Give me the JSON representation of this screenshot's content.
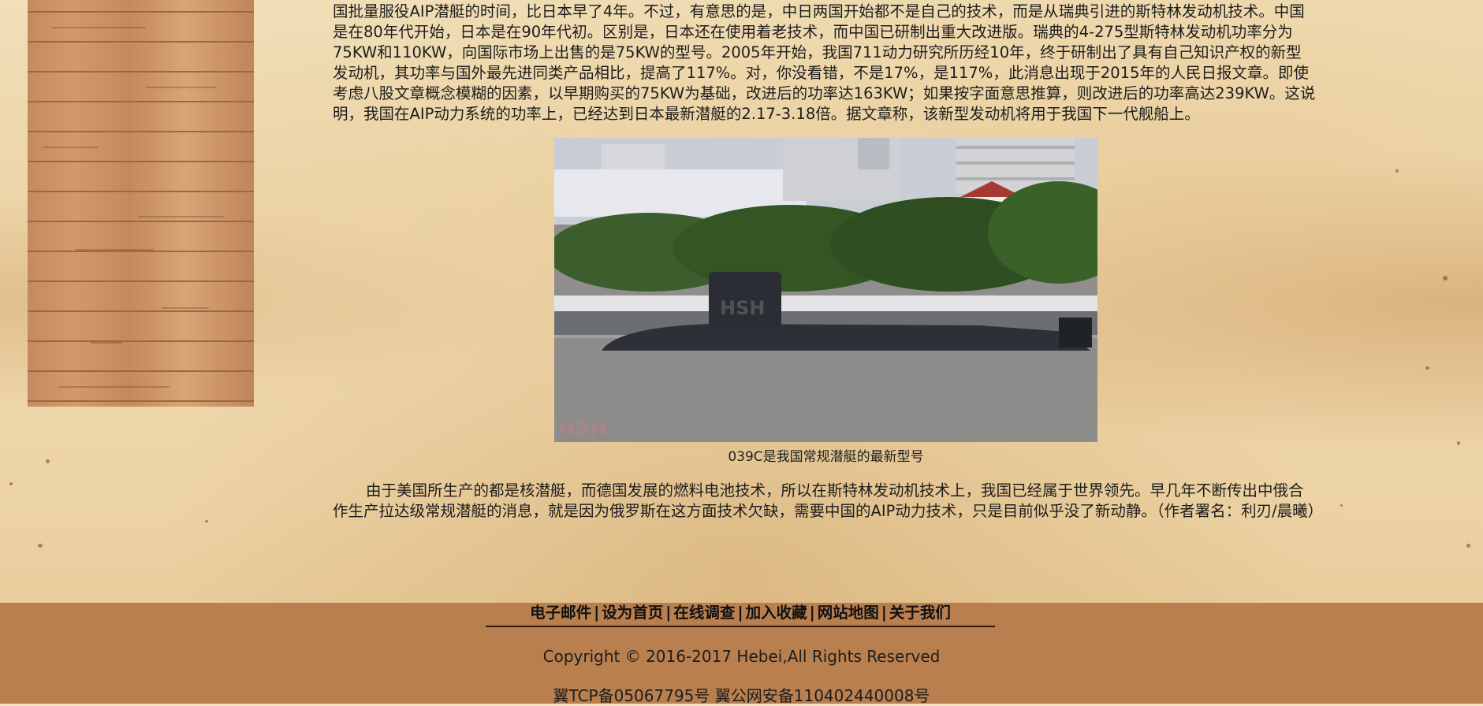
{
  "article": {
    "paragraph1": "国批量服役AIP潜艇的时间，比日本早了4年。不过，有意思的是，中日两国开始都不是自己的技术，而是从瑞典引进的斯特林发动机技术。中国是在80年代开始，日本是在90年代初。区别是，日本还在使用着老技术，而中国已研制出重大改进版。瑞典的4-275型斯特林发动机功率分为75KW和110KW，向国际市场上出售的是75KW的型号。2005年开始，我国711动力研究所历经10年，终于研制出了具有自己知识产权的新型发动机，其功率与国外最先进同类产品相比，提高了117%。对，你没看错，不是17%，是117%，此消息出现于2015年的人民日报文章。即使考虑八股文章概念模糊的因素，以早期购买的75KW为基础，改进后的功率达163KW；如果按字面意思推算，则改进后的功率高达239KW。这说明，我国在AIP动力系统的功率上，已经达到日本最新潜艇的2.17-3.18倍。据文章称，该新型发动机将用于我国下一代舰船上。",
    "photo_watermark_top": "HSH",
    "photo_watermark_bottom": "HSH",
    "caption": "039C是我国常规潜艇的最新型号",
    "paragraph2": "由于美国所生产的都是核潜艇，而德国发展的燃料电池技术，所以在斯特林发动机技术上，我国已经属于世界领先。早几年不断传出中俄合作生产拉达级常规潜艇的消息，就是因为俄罗斯在这方面技术欠缺，需要中国的AIP动力技术，只是目前似乎没了新动静。（作者署名：利刃/晨曦）"
  },
  "footer": {
    "links": [
      "电子邮件",
      "设为首页",
      "在线调查",
      "加入收藏",
      "网站地图",
      "关于我们"
    ],
    "separator": "|",
    "copyright": "Copyright © 2016-2017 Hebei,All Rights Reserved",
    "icp": "翼TCP备05067795号 翼公网安备110402440008号"
  },
  "colors": {
    "parchment": "#f2e1bb",
    "wood": "#c98e60",
    "footer": "#b97f4f",
    "text": "#1d1d1d"
  }
}
